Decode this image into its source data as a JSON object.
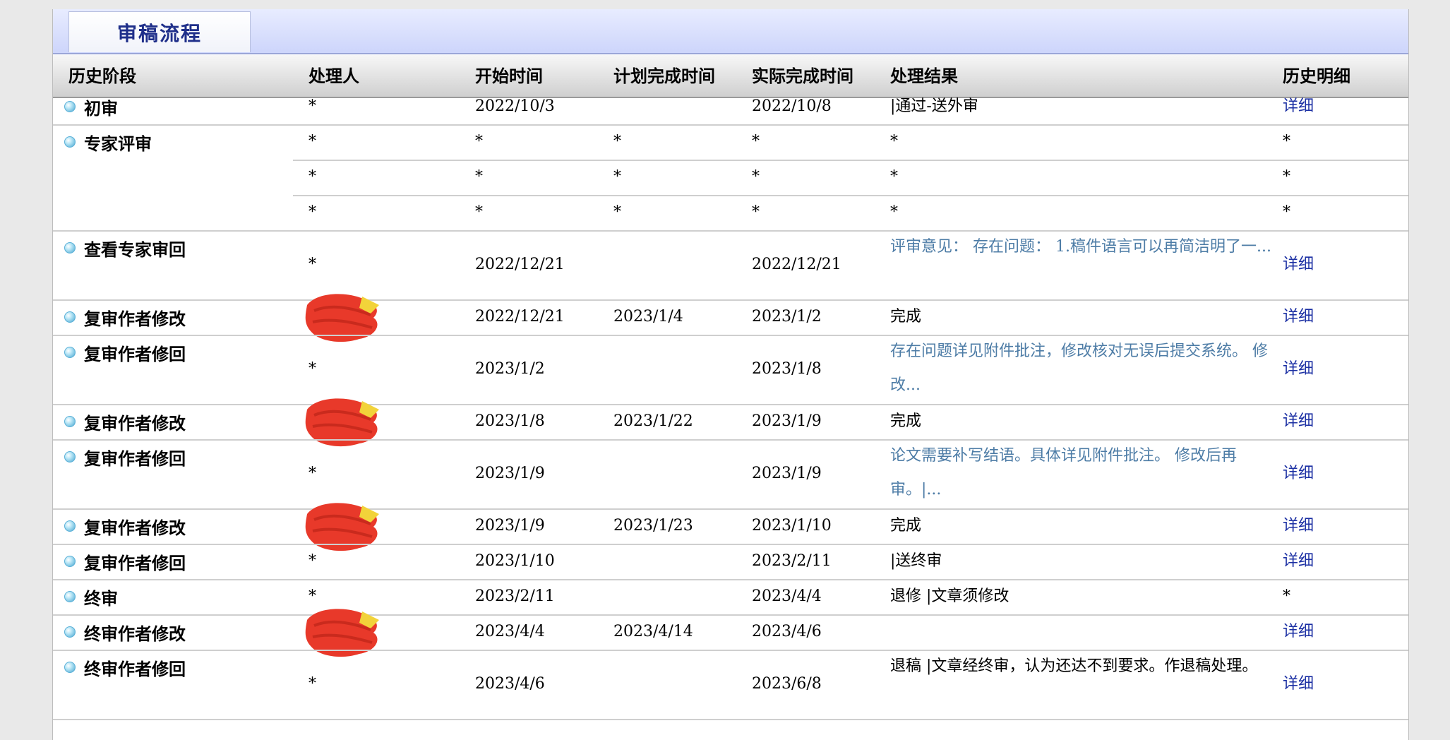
{
  "tab": {
    "title": "审稿流程"
  },
  "columns": [
    "历史阶段",
    "处理人",
    "开始时间",
    "计划完成时间",
    "实际完成时间",
    "处理结果",
    "历史明细"
  ],
  "rows": [
    {
      "stage": "初审",
      "handler": "*",
      "start": "2022/10/3",
      "planned": "",
      "actual": "2022/10/8",
      "result": "|通过-送外审",
      "detail": "详细"
    },
    {
      "stage": "专家评审",
      "handler": "*",
      "start": "*",
      "planned": "*",
      "actual": "*",
      "result": "*",
      "detail": "*"
    },
    {
      "stage": "",
      "handler": "*",
      "start": "*",
      "planned": "*",
      "actual": "*",
      "result": "*",
      "detail": "*"
    },
    {
      "stage": "",
      "handler": "*",
      "start": "*",
      "planned": "*",
      "actual": "*",
      "result": "*",
      "detail": "*"
    },
    {
      "stage": "查看专家审回",
      "handler": "*",
      "start": "2022/12/21",
      "planned": "",
      "actual": "2022/12/21",
      "result": "评审意见： 存在问题： 1.稿件语言可以再简洁明了一...",
      "detail": "详细"
    },
    {
      "stage": "复审作者修改",
      "handler": "",
      "start": "2022/12/21",
      "planned": "2023/1/4",
      "actual": "2023/1/2",
      "result": "完成",
      "detail": "详细"
    },
    {
      "stage": "复审作者修回",
      "handler": "*",
      "start": "2023/1/2",
      "planned": "",
      "actual": "2023/1/8",
      "result": "存在问题详见附件批注，修改核对无误后提交系统。 修改...",
      "detail": "详细"
    },
    {
      "stage": "复审作者修改",
      "handler": "",
      "start": "2023/1/8",
      "planned": "2023/1/22",
      "actual": "2023/1/9",
      "result": "完成",
      "detail": "详细"
    },
    {
      "stage": "复审作者修回",
      "handler": "*",
      "start": "2023/1/9",
      "planned": "",
      "actual": "2023/1/9",
      "result": "论文需要补写结语。具体详见附件批注。 修改后再审。|...",
      "detail": "详细"
    },
    {
      "stage": "复审作者修改",
      "handler": "",
      "start": "2023/1/9",
      "planned": "2023/1/23",
      "actual": "2023/1/10",
      "result": "完成",
      "detail": "详细"
    },
    {
      "stage": "复审作者修回",
      "handler": "*",
      "start": "2023/1/10",
      "planned": "",
      "actual": "2023/2/11",
      "result": "|送终审",
      "detail": "详细"
    },
    {
      "stage": "终审",
      "handler": "*",
      "start": "2023/2/11",
      "planned": "",
      "actual": "2023/4/4",
      "result": "退修 |文章须修改",
      "detail": "*"
    },
    {
      "stage": "终审作者修改",
      "handler": "",
      "start": "2023/4/4",
      "planned": "2023/4/14",
      "actual": "2023/4/6",
      "result": "",
      "detail": "详细"
    },
    {
      "stage": "终审作者修回",
      "handler": "*",
      "start": "2023/4/6",
      "planned": "",
      "actual": "2023/6/8",
      "result": "退稿 |文章经终审，认为还达不到要求。作退稿处理。",
      "detail": "详细"
    }
  ]
}
